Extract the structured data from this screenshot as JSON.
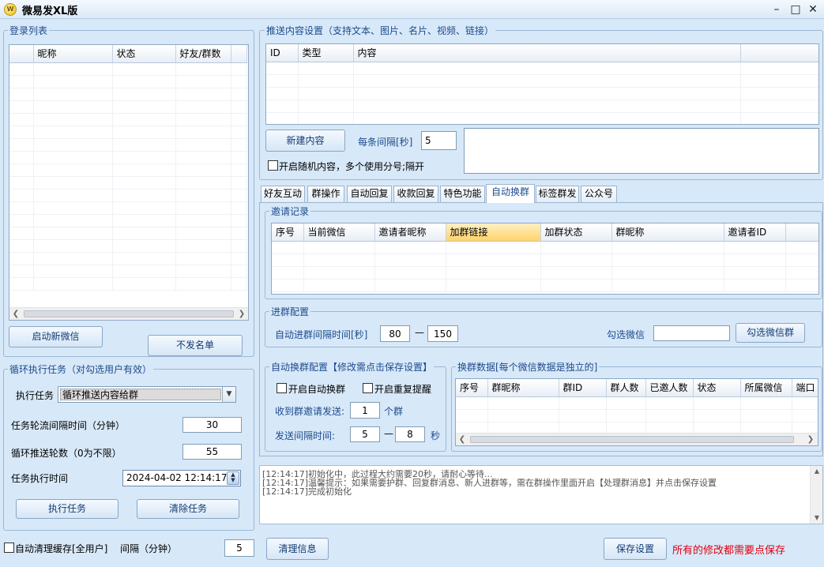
{
  "window": {
    "title": "微易发XL版",
    "icon_name": "app-logo-icon",
    "minimize": "–",
    "maximize": "□",
    "close": "✕"
  },
  "login": {
    "legend": "登录列表",
    "columns": [
      "",
      "昵称",
      "状态",
      "好友/群数"
    ],
    "start_button": "启动新微信",
    "blacklist_button": "不发名单"
  },
  "cycle": {
    "legend": "循环执行任务（对勾选用户有效）",
    "task_label": "执行任务",
    "task_value": "循环推送内容给群",
    "interval_label": "任务轮流间隔时间（分钟）",
    "interval_value": "30",
    "rounds_label": "循环推送轮数（0为不限）",
    "rounds_value": "55",
    "time_label": "任务执行时间",
    "time_value": "2024-04-02 12:14:17",
    "run_button": "执行任务",
    "clear_button": "清除任务"
  },
  "footer": {
    "autoclean_label": "自动清理缓存[全用户]",
    "interval_label": "间隔（分钟）",
    "interval_value": "5",
    "clear_log_button": "清理信息",
    "save_button": "保存设置",
    "warning": "所有的修改都需要点保存"
  },
  "push": {
    "legend": "推送内容设置（支持文本、图片、名片、视频、链接）",
    "columns": [
      "ID",
      "类型",
      "内容",
      ""
    ],
    "new_button": "新建内容",
    "gap_label": "每条间隔[秒]",
    "gap_value": "5",
    "random_label": "开启随机内容，多个使用分号;隔开"
  },
  "tabs": [
    "好友互动",
    "群操作",
    "自动回复",
    "收款回复",
    "特色功能",
    "自动换群",
    "标签群发",
    "公众号"
  ],
  "active_tab": "自动换群",
  "invite": {
    "legend": "邀请记录",
    "columns": [
      "序号",
      "当前微信",
      "邀请者昵称",
      "加群链接",
      "加群状态",
      "群昵称",
      "邀请者ID"
    ]
  },
  "join_config": {
    "legend": "进群配置",
    "interval_label": "自动进群间隔时间[秒]",
    "min_value": "80",
    "dash": "—",
    "max_value": "150",
    "select_label": "勾选微信",
    "select_value": "",
    "select_button": "勾选微信群"
  },
  "auto_swap": {
    "legend": "自动换群配置【修改需点击保存设置】",
    "enable_label": "开启自动换群",
    "repeat_label": "开启重复提醒",
    "recv_label": "收到群邀请发送:",
    "recv_value": "1",
    "recv_unit": "个群",
    "send_label": "发送间隔时间:",
    "send_min": "5",
    "dash": "—",
    "send_max": "8",
    "send_unit": "秒"
  },
  "swap_data": {
    "legend": "换群数据[每个微信数据是独立的]",
    "columns": [
      "序号",
      "群昵称",
      "群ID",
      "群人数",
      "已邀人数",
      "状态",
      "所属微信",
      "端口"
    ]
  },
  "log": [
    "[12:14:17]初始化中，此过程大约需要20秒，请耐心等待...",
    "[12:14:17]温馨提示：如果需要护群、回复群消息、新人进群等，需在群操作里面开启【处理群消息】并点击保存设置",
    "[12:14:17]完成初始化"
  ]
}
